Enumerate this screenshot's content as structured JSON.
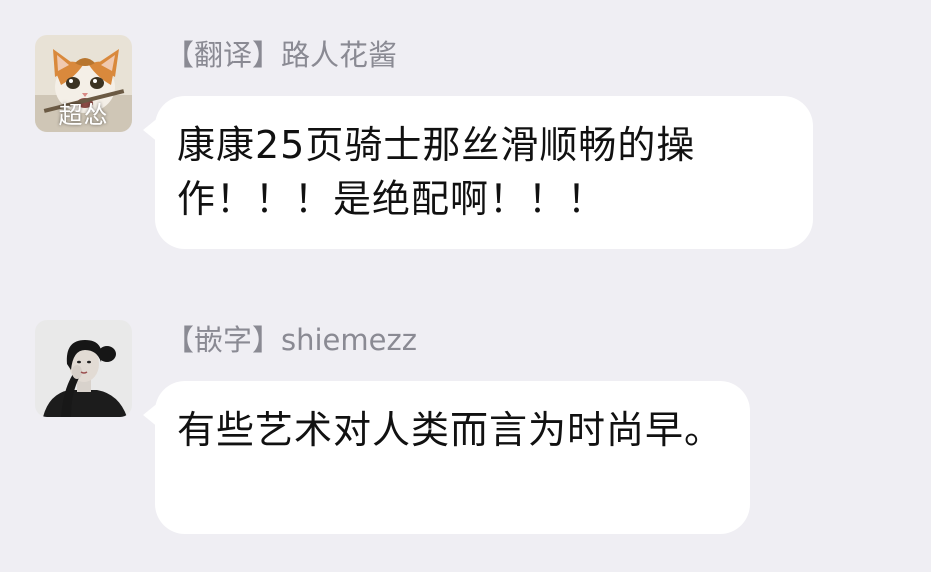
{
  "messages": [
    {
      "sender": "【翻译】路人花酱",
      "avatar_icon": "cat-photo-avatar",
      "avatar_caption": "超怂",
      "text": "康康25页骑士那丝滑顺畅的操作！！！是绝配啊！！！"
    },
    {
      "sender": "【嵌字】shiemezz",
      "avatar_icon": "woman-photo-avatar",
      "text": "有些艺术对人类而言为时尚早。"
    }
  ],
  "colors": {
    "background": "#efeef3",
    "bubble": "#ffffff",
    "sender_text": "#8a8a93",
    "message_text": "#111111"
  }
}
